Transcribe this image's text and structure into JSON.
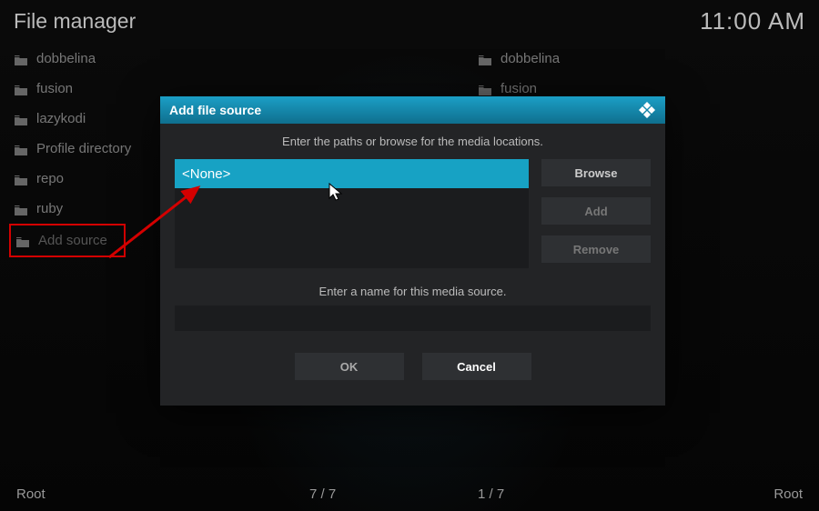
{
  "header": {
    "title": "File manager",
    "clock": "11:00 AM"
  },
  "columns": {
    "left": [
      {
        "label": "dobbelina"
      },
      {
        "label": "fusion"
      },
      {
        "label": "lazykodi"
      },
      {
        "label": "Profile directory"
      },
      {
        "label": "repo"
      },
      {
        "label": "ruby"
      },
      {
        "label": "Add source",
        "highlight": true
      }
    ],
    "right": [
      {
        "label": "dobbelina"
      },
      {
        "label": "fusion"
      }
    ]
  },
  "footer": {
    "left_root": "Root",
    "left_pos": "7 / 7",
    "right_pos": "1 / 7",
    "right_root": "Root"
  },
  "dialog": {
    "title": "Add file source",
    "instruction": "Enter the paths or browse for the media locations.",
    "path_value": "<None>",
    "browse": "Browse",
    "add": "Add",
    "remove": "Remove",
    "name_label": "Enter a name for this media source.",
    "name_value": "",
    "ok": "OK",
    "cancel": "Cancel"
  }
}
